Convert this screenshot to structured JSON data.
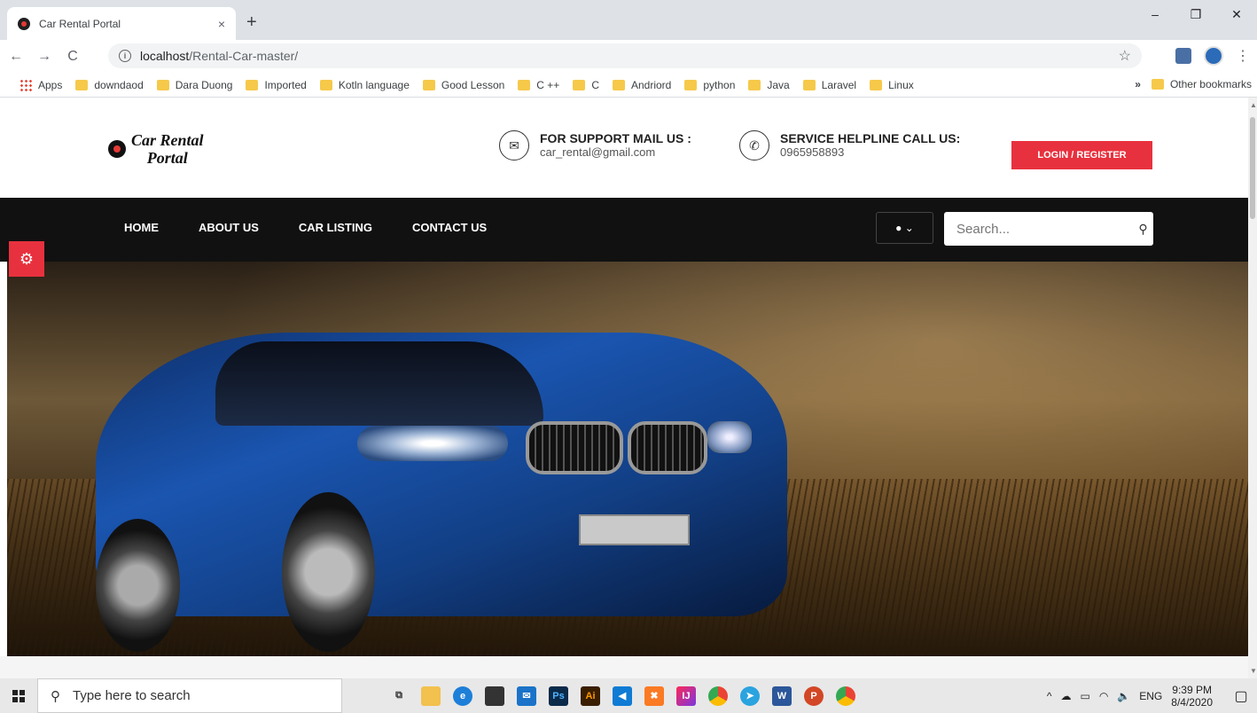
{
  "browser": {
    "tab_title": "Car Rental Portal",
    "tab_close": "×",
    "new_tab": "+",
    "window_buttons": [
      "–",
      "❐",
      "✕"
    ],
    "address_host": "localhost",
    "address_path": "/Rental-Car-master/",
    "bookmarks": [
      "Apps",
      "downdaod",
      "Dara Duong",
      "Imported",
      "Kotln language",
      "Good Lesson",
      "C ++",
      "C",
      "Andriord",
      "python",
      "Java",
      "Laravel",
      "Linux"
    ],
    "bookmarks_overflow": "»",
    "other_bookmarks": "Other bookmarks"
  },
  "site": {
    "logo_line1": "Car Rental",
    "logo_line2": "Portal",
    "mail_label": "FOR SUPPORT MAIL US :",
    "mail_value": "car_rental@gmail.com",
    "phone_label": "SERVICE HELPLINE CALL US:",
    "phone_value": "0965958893",
    "login_button": "LOGIN / REGISTER",
    "menu": [
      "HOME",
      "ABOUT US",
      "CAR LISTING",
      "CONTACT US"
    ],
    "search_placeholder": "Search...",
    "accent_color": "#e8313e",
    "nav_color": "#111111"
  },
  "taskbar": {
    "search_placeholder": "Type here to search",
    "tray_language": "ENG",
    "time": "9:39 PM",
    "date": "8/4/2020"
  }
}
